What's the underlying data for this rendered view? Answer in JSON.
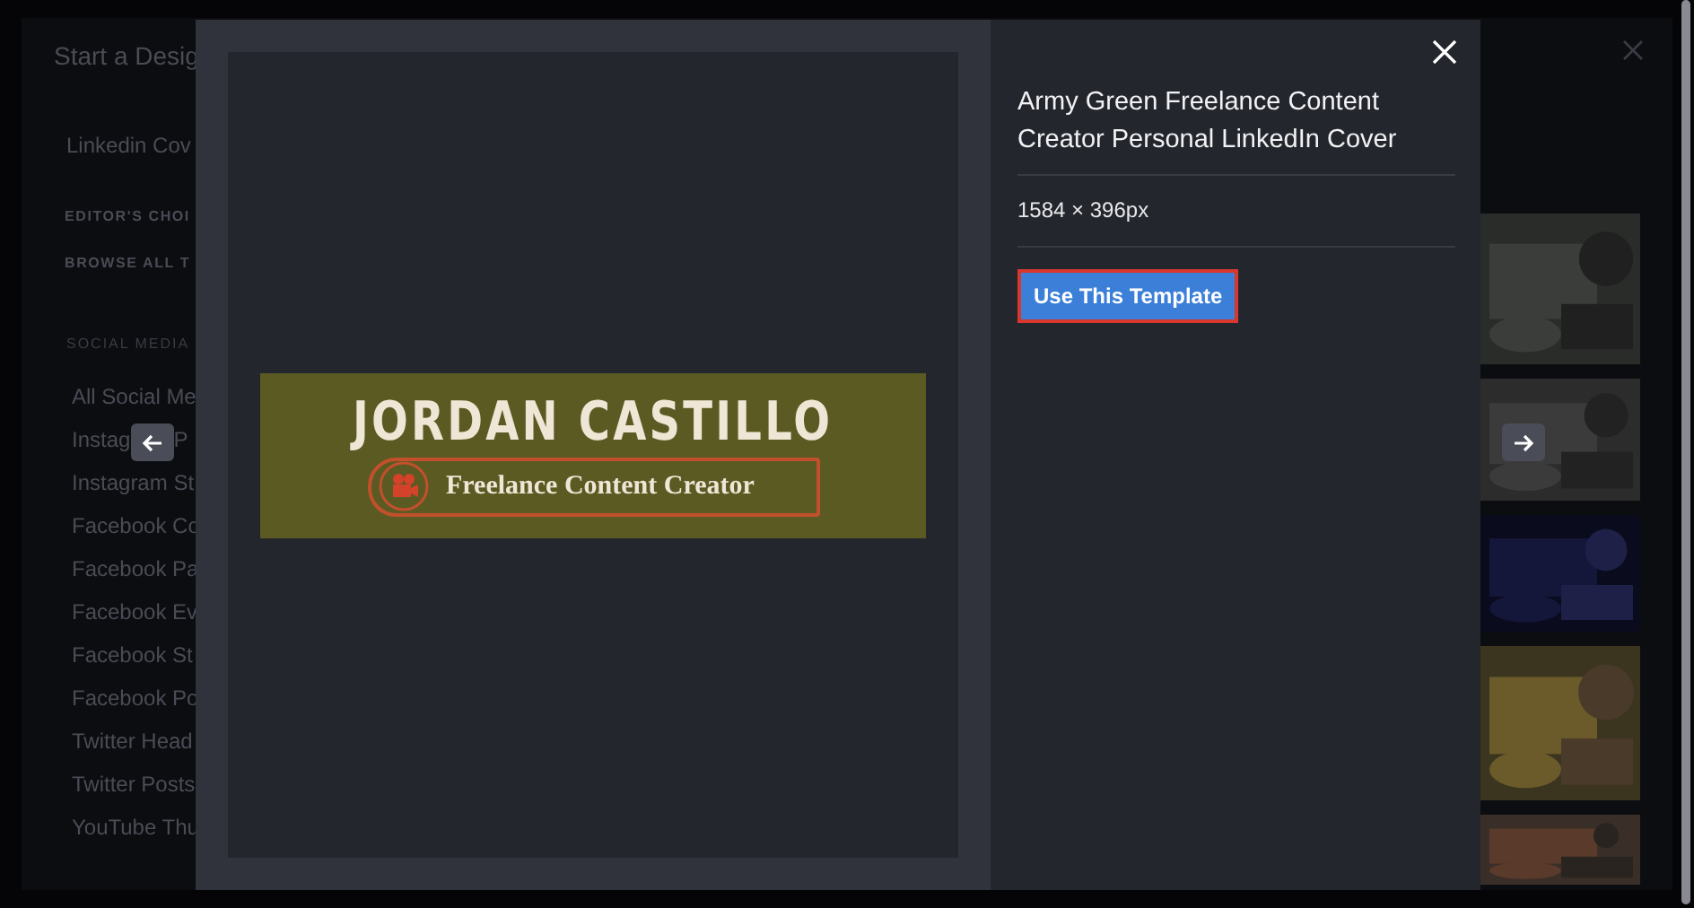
{
  "background_dialog": {
    "title": "Start a Desig",
    "category": "Linkedin Cov",
    "links": [
      "EDITOR'S CHOI",
      "BROWSE ALL T"
    ],
    "section_heading": "SOCIAL MEDIA",
    "items": [
      "All Social Me",
      {
        "label": "Instag",
        "continuation": "P"
      },
      "Instagram St",
      "Facebook Co",
      "Facebook Pa",
      "Facebook Ev",
      "Facebook St",
      "Facebook Po",
      "Twitter Head",
      "Twitter Posts",
      "YouTube Thu"
    ]
  },
  "template": {
    "banner": {
      "name": "JORDAN CASTILLO",
      "tagline": "Freelance Content Creator"
    },
    "title": "Army Green Freelance Content Creator Personal LinkedIn Cover",
    "size": "1584 × 396px",
    "button": "Use This Template"
  }
}
